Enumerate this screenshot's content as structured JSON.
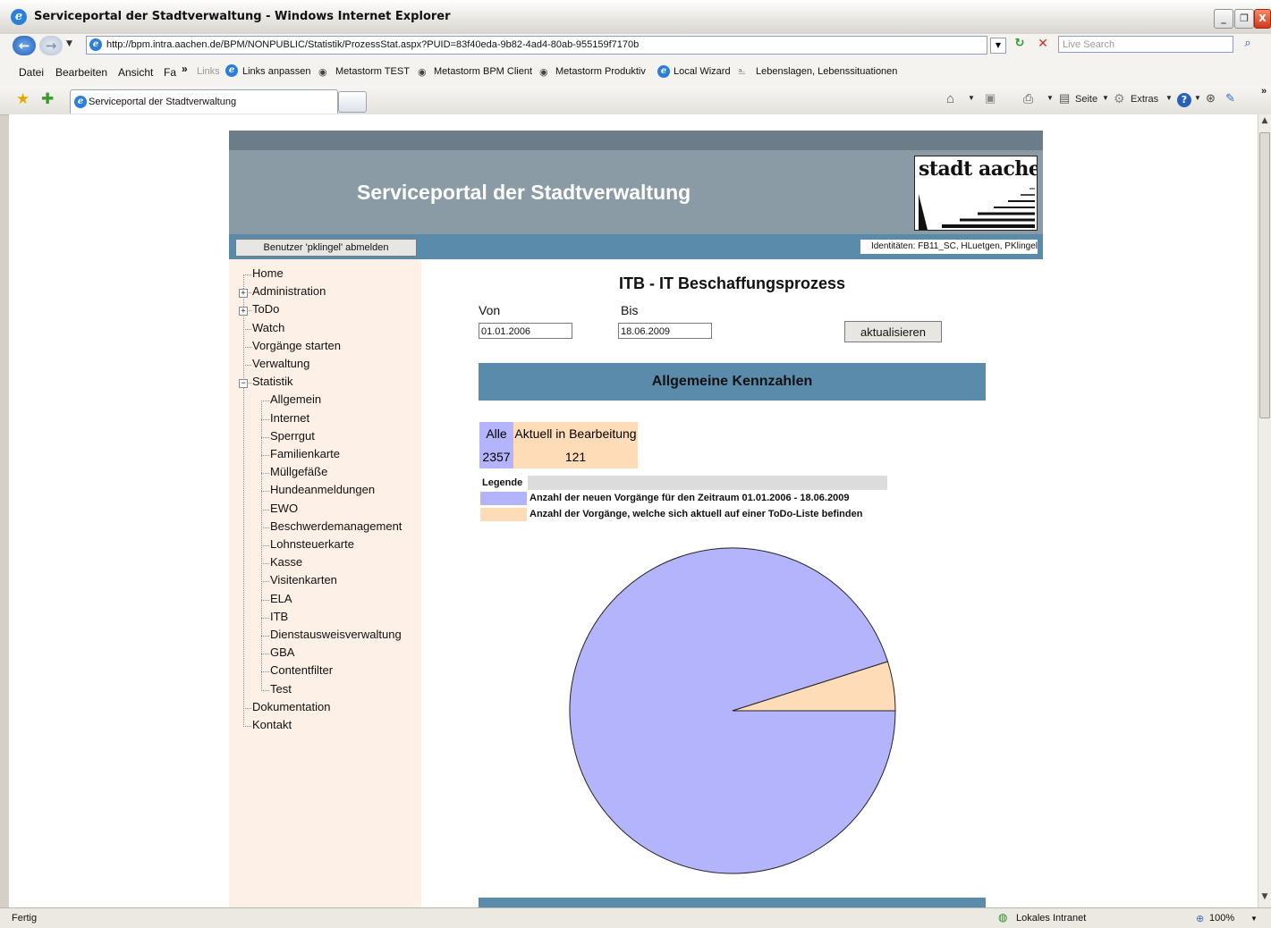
{
  "window": {
    "title": "Serviceportal der Stadtverwaltung - Windows Internet Explorer",
    "controls": [
      "_",
      "❐",
      "X"
    ]
  },
  "addressbar": {
    "url": "http://bpm.intra.aachen.de/BPM/NONPUBLIC/Statistik/ProzessStat.aspx?PUID=83f40eda-9b82-4ad4-80ab-955159f7170b",
    "search_placeholder": "Live Search"
  },
  "menubar": {
    "items": [
      "Datei",
      "Bearbeiten",
      "Ansicht",
      "Fa"
    ],
    "more": "»",
    "links_label": "Links",
    "links": [
      "Links anpassen",
      "Metastorm TEST",
      "Metastorm BPM Client",
      "Metastorm Produktiv",
      "Local Wizard",
      "Lebenslagen, Lebenssituationen"
    ]
  },
  "tabbar": {
    "tab_title": "Serviceportal der Stadtverwaltung",
    "tools": [
      "Seite",
      "Extras"
    ],
    "more": "»"
  },
  "page": {
    "header_title": "Serviceportal der Stadtverwaltung",
    "logo_text": "stadt aachen",
    "logout_label": "Benutzer 'pklingel' abmelden",
    "identities": "Identitäten: FB11_SC, HLuetgen, PKlingel"
  },
  "nav": {
    "top": [
      {
        "label": "Home",
        "expander": ""
      },
      {
        "label": "Administration",
        "expander": "+"
      },
      {
        "label": "ToDo",
        "expander": "+"
      },
      {
        "label": "Watch",
        "expander": ""
      },
      {
        "label": "Vorgänge starten",
        "expander": ""
      },
      {
        "label": "Verwaltung",
        "expander": ""
      },
      {
        "label": "Statistik",
        "expander": "−"
      }
    ],
    "statistik_children": [
      "Allgemein",
      "Internet",
      "Sperrgut",
      "Familienkarte",
      "Müllgefäße",
      "Hundeanmeldungen",
      "EWO",
      "Beschwerdemanagement",
      "Lohnsteuerkarte",
      "Kasse",
      "Visitenkarten",
      "ELA",
      "ITB",
      "Dienstausweisverwaltung",
      "GBA",
      "Contentfilter",
      "Test"
    ],
    "bottom": [
      "Dokumentation",
      "Kontakt"
    ]
  },
  "main": {
    "title": "ITB - IT Beschaffungsprozess",
    "from_label": "Von",
    "to_label": "Bis",
    "from_value": "01.01.2006",
    "to_value": "18.06.2009",
    "refresh_label": "aktualisieren",
    "section_title": "Allgemeine Kennzahlen",
    "table": {
      "headers": [
        "Alle",
        "Aktuell in Bearbeitung"
      ],
      "values": [
        "2357",
        "121"
      ]
    },
    "legend": {
      "title": "Legende",
      "items": [
        {
          "text": "Anzahl der neuen Vorgänge für den Zeitraum 01.01.2006 - 18.06.2009",
          "color": "#b4b4fc"
        },
        {
          "text": "Anzahl der Vorgänge, welche sich aktuell auf einer ToDo-Liste befinden",
          "color": "#fedcb8"
        }
      ]
    }
  },
  "chart_data": {
    "type": "pie",
    "categories": [
      "Alle",
      "Aktuell in Bearbeitung"
    ],
    "values": [
      2357,
      121
    ],
    "colors": [
      "#b4b4fc",
      "#fedcb8"
    ]
  },
  "statusbar": {
    "text": "Fertig",
    "zone": "Lokales Intranet",
    "zoom": "100%"
  },
  "colors": {
    "header_bg": "#8a9ba6",
    "bar_blue": "#5b8bab",
    "sidebar_bg": "#fdf0e6"
  }
}
